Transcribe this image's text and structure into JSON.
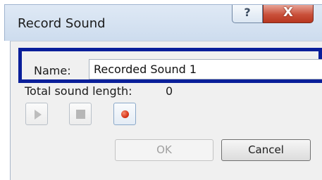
{
  "window": {
    "title": "Record Sound",
    "help_glyph": "?",
    "close_glyph": "X"
  },
  "form": {
    "name_label": "Name:",
    "name_value": "Recorded Sound 1",
    "length_label": "Total sound length:",
    "length_value": "0"
  },
  "media": {
    "play_icon": "play-icon",
    "stop_icon": "stop-icon",
    "record_icon": "record-icon"
  },
  "buttons": {
    "ok_label": "OK",
    "cancel_label": "Cancel"
  },
  "colors": {
    "highlight": "#0a1f9a",
    "record_red": "#d8361a",
    "close_red": "#c9503a"
  }
}
